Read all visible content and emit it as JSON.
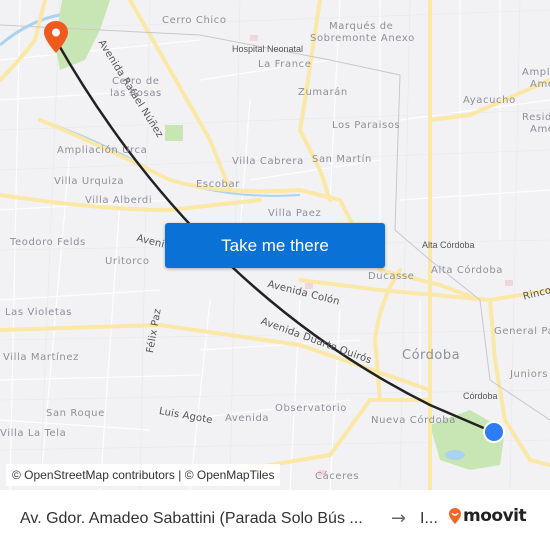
{
  "map": {
    "labels": {
      "cerro_chico": "Cerro Chico",
      "marques_1": "Marqués de",
      "marques_2": "Sobremonte Anexo",
      "hospital": "Hospital Neonatal",
      "la_france": "La France",
      "ampl_1": "Ampl",
      "ampl_2": "Ame",
      "resid_1": "Resid",
      "resid_2": "Ame",
      "av_rafael_nunez": "Avenida Rafael Núñez",
      "cerro_rosas_1": "Cerro de",
      "cerro_rosas_2": "las Rosas",
      "zumaran": "Zumarán",
      "ayacucho": "Ayacucho",
      "los_paraisos": "Los Paraisos",
      "ampliacion_urca": "Ampliación Urca",
      "villa_cabrera": "Villa Cabrera",
      "san_martin": "San Martín",
      "villa_urquiza": "Villa Urquiza",
      "escobar": "Escobar",
      "villa_alberdi": "Villa Alberdi",
      "villa_paez": "Villa Paez",
      "teodoro_felds": "Teodoro Felds",
      "avenida_partial": "Aveni",
      "alta_cordoba_small": "Alta Córdoba",
      "uritorco": "Uritorco",
      "ducasse": "Ducasse",
      "alta_cordoba": "Alta Córdoba",
      "rincon": "Rinco",
      "avenida_colon": "Avenida Colón",
      "las_violetas": "Las Violetas",
      "felix_paz": "Félix Paz",
      "general_paz": "General Pa",
      "avenida_duarte_quiros": "Avenida Duarte Quirós",
      "cordoba_big": "Córdoba",
      "villa_martinez": "Villa Martínez",
      "juniors": "Juniors",
      "cordoba_small": "Córdoba",
      "observatorio": "Observatorio",
      "san_roque": "San Roque",
      "luis_agote": "Luis Agote",
      "avenida": "Avenida",
      "nueva_cordoba": "Nueva Córdoba",
      "villa_la_tela": "Villa La Tela",
      "caceres": "Cáceres"
    },
    "colors": {
      "route": "#222222",
      "destination_pin": "#f05a1e",
      "origin_dot": "#2e7cf6",
      "major_road": "#fbe7a6",
      "park": "#c8e6b4",
      "water": "#a9d3ef"
    }
  },
  "action": {
    "take_me_there": "Take me there"
  },
  "attribution": "© OpenStreetMap contributors | © OpenMapTiles",
  "footer": {
    "from": "Av. Gdor. Amadeo Sabattini (Parada Solo Bús ...",
    "arrow": "→",
    "to": "I...",
    "brand": "moovit",
    "brand_color": "#f26722"
  }
}
